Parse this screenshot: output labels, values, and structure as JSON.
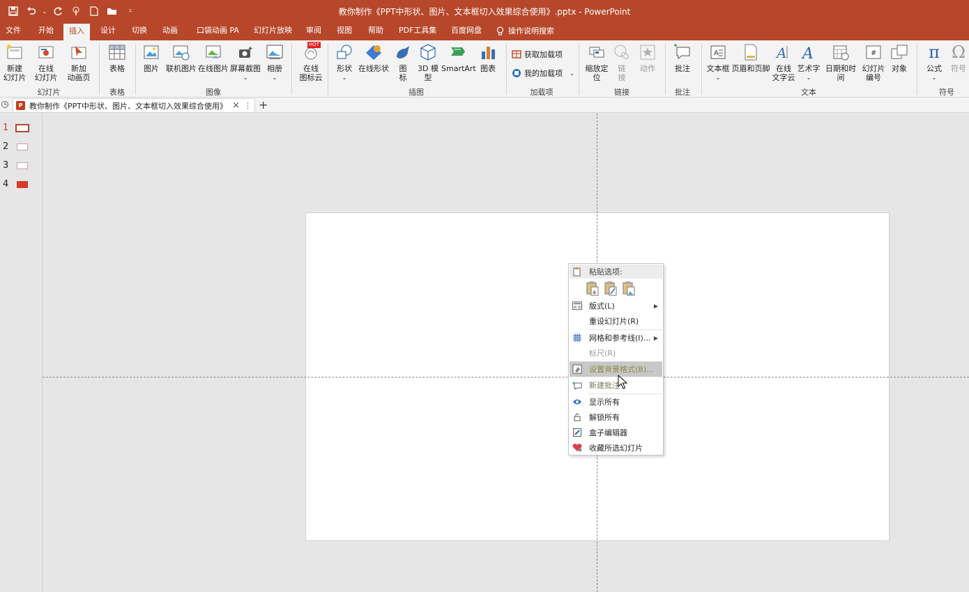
{
  "window": {
    "title": "教你制作《PPT中形状、图片、文本框切入效果综合使用》.pptx  -  PowerPoint",
    "qat_icons": [
      "save-icon",
      "undo-icon",
      "redo-icon",
      "touch-mode-icon",
      "new-file-icon",
      "open-file-icon",
      "customize-qat-icon"
    ]
  },
  "tabs": [
    {
      "label": "文件"
    },
    {
      "label": "开始"
    },
    {
      "label": "插入",
      "active": true
    },
    {
      "label": "设计"
    },
    {
      "label": "切换"
    },
    {
      "label": "动画"
    },
    {
      "label": "口袋动画 PA"
    },
    {
      "label": "幻灯片放映"
    },
    {
      "label": "审阅"
    },
    {
      "label": "视图"
    },
    {
      "label": "帮助"
    },
    {
      "label": "PDF工具集"
    },
    {
      "label": "百度网盘"
    }
  ],
  "tell_me": "操作说明搜索",
  "ribbon": {
    "buttons": {
      "new_slide": "新建\n幻灯片",
      "online_slide": "在线\n幻灯片",
      "new_anim_page": "新加\n动画页",
      "table": "表格",
      "picture": "图片",
      "online_picture": "联机图片",
      "online_image": "在线图片",
      "screenshot": "屏幕截图",
      "album": "相册",
      "icon_cloud": "在线\n图标云",
      "shapes": "形状",
      "online_shapes": "在线形状",
      "icons": "图\n标",
      "model3d": "3D 模\n型",
      "smartart": "SmartArt",
      "chart": "图表",
      "get_addins": "获取加载项",
      "my_addins": "我的加载项",
      "zoom": "缩放定\n位",
      "link": "链\n接",
      "action": "动作",
      "comment": "批注",
      "textbox": "文本框",
      "header_footer": "页眉和页脚",
      "online_text_cloud": "在线\n文字云",
      "wordart": "艺术字",
      "date_time": "日期和时间",
      "slide_number": "幻灯片\n编号",
      "object": "对象",
      "equation": "公式",
      "symbol": "符号"
    },
    "groups": {
      "slides": "幻灯片",
      "tables": "表格",
      "images": "图像",
      "illustrations": "插图",
      "addins": "加载项",
      "links": "链接",
      "comments": "批注",
      "text": "文本",
      "symbols": "符号"
    },
    "hot_badge": "HOT"
  },
  "doc_tab": {
    "label": "教你制作《PPT中形状、图片、文本框切入效果综合使用》.p",
    "close": "×",
    "more": "⋮",
    "add": "+"
  },
  "thumbnails": [
    {
      "num": "1",
      "selected": true
    },
    {
      "num": "2"
    },
    {
      "num": "3"
    },
    {
      "num": "4"
    }
  ],
  "context_menu": {
    "paste_header": "粘贴选项:",
    "items": [
      {
        "label": "版式(L)",
        "icon": "layout-icon",
        "submenu": true
      },
      {
        "label": "重设幻灯片(R)",
        "icon": ""
      },
      {
        "label": "网格和参考线(I)...",
        "icon": "grid-icon",
        "submenu": true
      },
      {
        "label": "标尺(R)",
        "icon": "",
        "disabled": true
      },
      {
        "label": "设置背景格式(B)...",
        "icon": "format-background-icon",
        "hover": true
      },
      {
        "label": "新建批注",
        "icon": "new-comment-icon"
      },
      {
        "label": "显示所有",
        "icon": "eye-icon"
      },
      {
        "label": "解锁所有",
        "icon": "unlock-icon"
      },
      {
        "label": "盒子编辑器",
        "icon": "pencil-icon"
      },
      {
        "label": "收藏所选幻灯片",
        "icon": "heart-icon"
      }
    ]
  },
  "colors": {
    "accent": "#b7472a",
    "ribbon_bg": "#f3f3f3",
    "workspace": "#e6e6e6",
    "highlight": "#fff028"
  }
}
